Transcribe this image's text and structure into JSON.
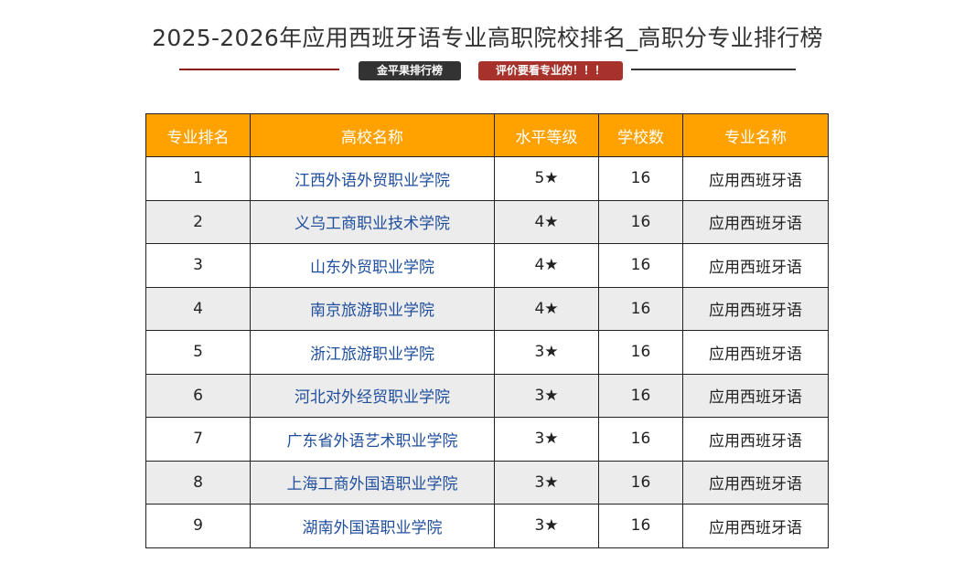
{
  "title": "2025-2026年应用西班牙语专业高职院校排名_高职分专业排行榜",
  "tags": {
    "brand": "金平果排行榜",
    "notice": "评价要看专业的！！！"
  },
  "table": {
    "headers": [
      "专业排名",
      "高校名称",
      "水平等级",
      "学校数",
      "专业名称"
    ],
    "rows": [
      {
        "rank": "1",
        "school": "江西外语外贸职业学院",
        "level": "5★",
        "count": "16",
        "major": "应用西班牙语"
      },
      {
        "rank": "2",
        "school": "义乌工商职业技术学院",
        "level": "4★",
        "count": "16",
        "major": "应用西班牙语"
      },
      {
        "rank": "3",
        "school": "山东外贸职业学院",
        "level": "4★",
        "count": "16",
        "major": "应用西班牙语"
      },
      {
        "rank": "4",
        "school": "南京旅游职业学院",
        "level": "4★",
        "count": "16",
        "major": "应用西班牙语"
      },
      {
        "rank": "5",
        "school": "浙江旅游职业学院",
        "level": "3★",
        "count": "16",
        "major": "应用西班牙语"
      },
      {
        "rank": "6",
        "school": "河北对外经贸职业学院",
        "level": "3★",
        "count": "16",
        "major": "应用西班牙语"
      },
      {
        "rank": "7",
        "school": "广东省外语艺术职业学院",
        "level": "3★",
        "count": "16",
        "major": "应用西班牙语"
      },
      {
        "rank": "8",
        "school": "上海工商外国语职业学院",
        "level": "3★",
        "count": "16",
        "major": "应用西班牙语"
      },
      {
        "rank": "9",
        "school": "湖南外国语职业学院",
        "level": "3★",
        "count": "16",
        "major": "应用西班牙语"
      }
    ]
  },
  "colors": {
    "header_bg": "#ffa200",
    "link": "#1f4e9d",
    "stripe": "#ececec",
    "tag_dark": "#333333",
    "tag_red": "#a6322b"
  }
}
